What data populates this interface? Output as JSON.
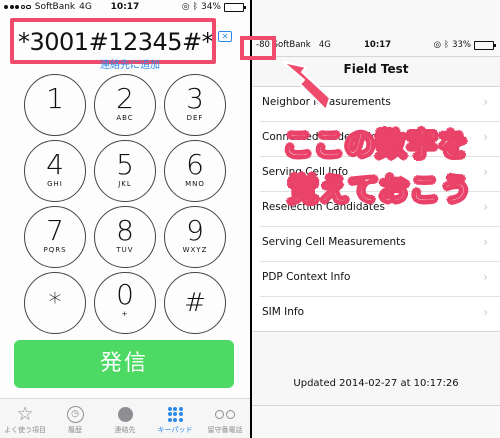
{
  "left": {
    "status": {
      "carrier": "SoftBank",
      "network": "4G",
      "time": "10:17",
      "battery": "34%",
      "battery_level": 0.34,
      "signal_bars": 3
    },
    "dialed_number": "*3001#12345#*",
    "add_contact": "連絡先に追加",
    "keys": [
      {
        "digit": "1",
        "letters": ""
      },
      {
        "digit": "2",
        "letters": "ABC"
      },
      {
        "digit": "3",
        "letters": "DEF"
      },
      {
        "digit": "4",
        "letters": "GHI"
      },
      {
        "digit": "5",
        "letters": "JKL"
      },
      {
        "digit": "6",
        "letters": "MNO"
      },
      {
        "digit": "7",
        "letters": "PQRS"
      },
      {
        "digit": "8",
        "letters": "TUV"
      },
      {
        "digit": "9",
        "letters": "WXYZ"
      },
      {
        "digit": "*",
        "letters": ""
      },
      {
        "digit": "0",
        "letters": "+"
      },
      {
        "digit": "#",
        "letters": ""
      }
    ],
    "call_label": "発信",
    "tabs": [
      {
        "label": "よく使う項目",
        "icon": "star-icon"
      },
      {
        "label": "履歴",
        "icon": "clock-icon"
      },
      {
        "label": "連絡先",
        "icon": "contacts-icon"
      },
      {
        "label": "キーパッド",
        "icon": "keypad-icon",
        "active": true
      },
      {
        "label": "留守番電話",
        "icon": "voicemail-icon"
      }
    ]
  },
  "right": {
    "status": {
      "signal": "-80",
      "carrier": "SoftBank",
      "network": "4G",
      "time": "10:17",
      "battery": "33%",
      "battery_level": 0.33
    },
    "title": "Field Test",
    "rows": [
      "Neighbor Measurements",
      "Connected Mode Neighbor Measu",
      "Serving Cell Info",
      "Reselection Candidates",
      "Serving Cell Measurements",
      "PDP Context Info",
      "SIM Info"
    ],
    "updated": "Updated 2014-02-27 at 10:17:26"
  },
  "annotation": {
    "line1": "ここの数字を",
    "line2": "覚えておこう"
  },
  "colors": {
    "accent": "#2b8ae8",
    "call": "#4cd964",
    "highlight": "#ee4b6d"
  }
}
